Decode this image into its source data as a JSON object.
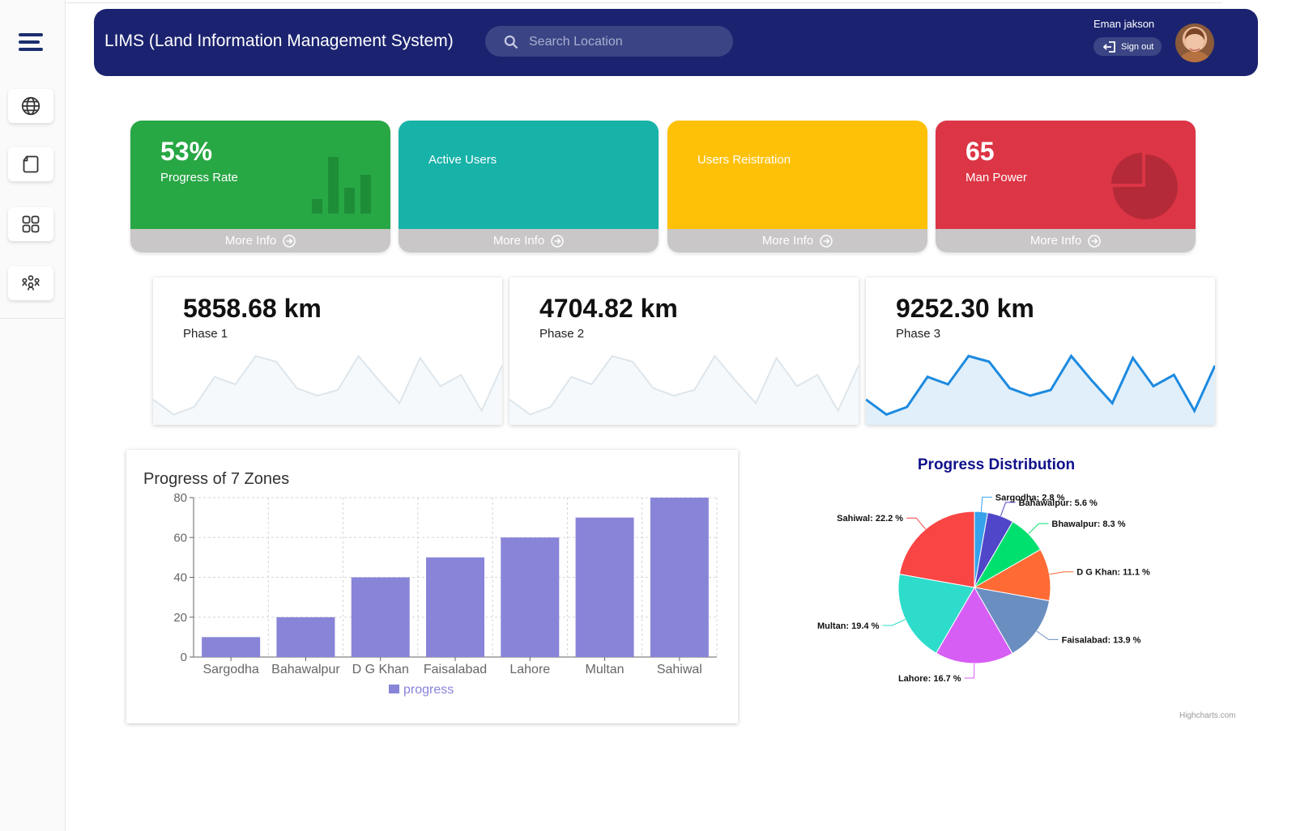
{
  "header": {
    "title": "LIMS (Land Information Management System)",
    "search_placeholder": "Search Location",
    "user_name": "Eman jakson",
    "signout_label": "Sign out"
  },
  "sidebar": {
    "items": [
      {
        "icon": "menu-icon"
      },
      {
        "icon": "globe-icon"
      },
      {
        "icon": "folder-icon"
      },
      {
        "icon": "grid-icon"
      },
      {
        "icon": "group-icon"
      }
    ]
  },
  "stat_cards": [
    {
      "value": "53%",
      "label": "Progress Rate",
      "footer": "More Info",
      "color": "#28a745"
    },
    {
      "value": "",
      "label": "Active Users",
      "footer": "More Info",
      "color": "#17b2a8"
    },
    {
      "value": "",
      "label": "Users Reistration",
      "footer": "More Info",
      "color": "#ffc107"
    },
    {
      "value": "65",
      "label": "Man Power",
      "footer": "More Info",
      "color": "#dc3545"
    }
  ],
  "km_cards": [
    {
      "value": "5858.68 km",
      "label": "Phase 1"
    },
    {
      "value": "4704.82 km",
      "label": "Phase 2"
    },
    {
      "value": "9252.30 km",
      "label": "Phase 3"
    }
  ],
  "bar_chart": {
    "title": "Progress of 7 Zones",
    "legend": "progress"
  },
  "pie_chart": {
    "title": "Progress Distribution",
    "credit": "Highcharts.com"
  },
  "chart_data": [
    {
      "type": "bar",
      "title": "Progress of 7 Zones",
      "categories": [
        "Sargodha",
        "Bahawalpur",
        "D G Khan",
        "Faisalabad",
        "Lahore",
        "Multan",
        "Sahiwal"
      ],
      "series": [
        {
          "name": "progress",
          "values": [
            10,
            20,
            40,
            50,
            60,
            70,
            80
          ],
          "color": "#8884d8"
        }
      ],
      "ylim": [
        0,
        80
      ],
      "yticks": [
        0,
        20,
        40,
        60,
        80
      ],
      "grid": true,
      "legend": "bottom"
    },
    {
      "type": "pie",
      "title": "Progress Distribution",
      "slices": [
        {
          "name": "Sargodha",
          "label": "Sargodha: 2.8 %",
          "value": 2.8,
          "color": "#36a2eb"
        },
        {
          "name": "Bahawalpur",
          "label": "Bahawalpur: 5.6 %",
          "value": 5.6,
          "color": "#4f46c9"
        },
        {
          "name": "Bhawalpur",
          "label": "Bhawalpur: 8.3 %",
          "value": 8.3,
          "color": "#00e06f"
        },
        {
          "name": "D G Khan",
          "label": "D G Khan: 11.1 %",
          "value": 11.1,
          "color": "#ff6a35"
        },
        {
          "name": "Faisalabad",
          "label": "Faisalabad: 13.9 %",
          "value": 13.9,
          "color": "#6a8ec0"
        },
        {
          "name": "Lahore",
          "label": "Lahore: 16.7 %",
          "value": 16.7,
          "color": "#d65ef5"
        },
        {
          "name": "Multan",
          "label": "Multan: 19.4 %",
          "value": 19.4,
          "color": "#2edccb"
        },
        {
          "name": "Sahiwal",
          "label": "Sahiwal: 22.2 %",
          "value": 22.2,
          "color": "#fa4545"
        }
      ]
    },
    {
      "type": "line",
      "name": "Phase 1",
      "values": [
        10,
        2,
        6,
        22,
        18,
        33,
        30,
        16,
        12,
        15,
        33,
        20,
        8,
        32,
        17,
        23,
        4,
        28
      ]
    },
    {
      "type": "line",
      "name": "Phase 2",
      "values": [
        10,
        2,
        6,
        22,
        18,
        33,
        30,
        16,
        12,
        15,
        33,
        20,
        8,
        32,
        17,
        23,
        4,
        28
      ]
    },
    {
      "type": "line",
      "name": "Phase 3",
      "values": [
        10,
        2,
        6,
        22,
        18,
        33,
        30,
        16,
        12,
        15,
        33,
        20,
        8,
        32,
        17,
        23,
        4,
        28
      ]
    }
  ]
}
